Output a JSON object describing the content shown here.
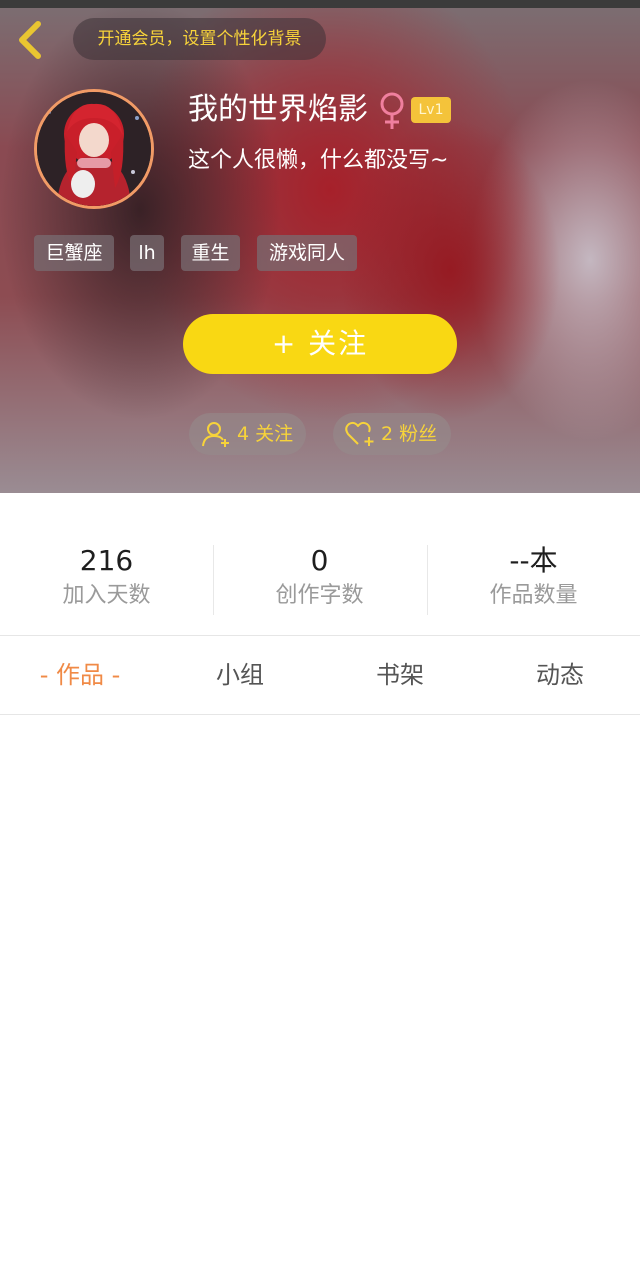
{
  "header": {
    "vip_banner": "开通会员，设置个性化背景",
    "username": "我的世界焰影",
    "gender_symbol": "♀",
    "level": "Lv1",
    "bio": "这个人很懒，什么都没写~",
    "tags": [
      "巨蟹座",
      "lh",
      "重生",
      "游戏同人"
    ],
    "follow_label": "+  关注",
    "following_label": "4 关注",
    "fans_label": "2 粉丝"
  },
  "stats": [
    {
      "value": "216",
      "label": "加入天数"
    },
    {
      "value": "0",
      "label": "创作字数"
    },
    {
      "value": "--本",
      "label": "作品数量"
    }
  ],
  "tabs": [
    {
      "label": "- 作品 -",
      "active": true
    },
    {
      "label": "小组",
      "active": false
    },
    {
      "label": "书架",
      "active": false
    },
    {
      "label": "动态",
      "active": false
    }
  ],
  "colors": {
    "accent_yellow": "#f9d813",
    "tab_active": "#f08a46",
    "gender_pink": "#f07f9e"
  },
  "icons": {
    "back": "chevron-left-icon",
    "gender": "female-icon",
    "following": "user-add-icon",
    "fans": "heart-add-icon"
  }
}
